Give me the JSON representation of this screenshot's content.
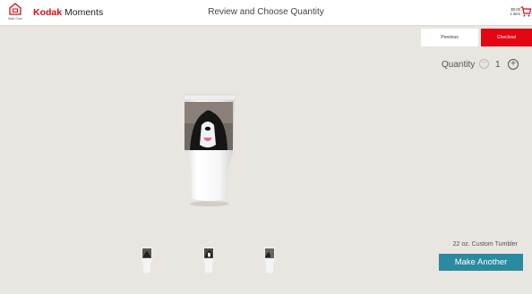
{
  "header": {
    "start_over_label": "Start Over",
    "brand_bold": "Kodak",
    "brand_rest": " Moments",
    "title": "Review and Choose Quantity",
    "cart_total": "$0.00",
    "cart_count": "1 item"
  },
  "nav": {
    "previous_label": "Previous",
    "checkout_label": "Checkout"
  },
  "quantity": {
    "label": "Quantity",
    "value": "1",
    "minus_symbol": "−",
    "plus_symbol": "+"
  },
  "product": {
    "name": "22 oz. Custom Tumbler",
    "preview_icon": "dog-photo-tumbler-image",
    "thumbnails": [
      "tumbler-view-1",
      "tumbler-view-2",
      "tumbler-view-3"
    ]
  },
  "actions": {
    "make_another_label": "Make Another"
  },
  "colors": {
    "brand_red": "#e30613",
    "accent_teal": "#2a8a9f",
    "background": "#e9e5e1"
  }
}
